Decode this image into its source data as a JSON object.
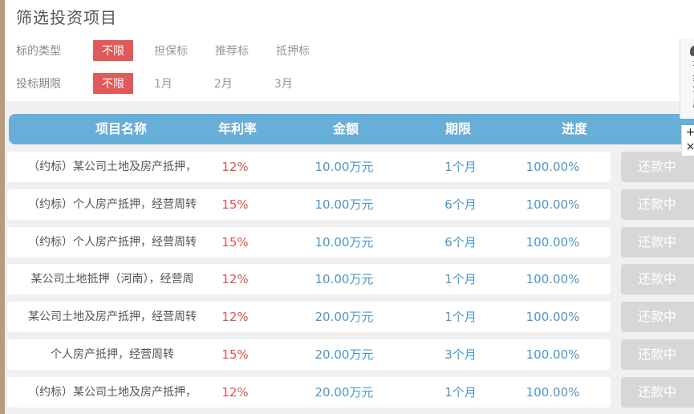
{
  "page_title": "筛选投资项目",
  "filters": [
    {
      "label": "标的类型",
      "options": [
        "不限",
        "担保标",
        "推荐标",
        "抵押标"
      ],
      "selected": 0
    },
    {
      "label": "投标期限",
      "options": [
        "不限",
        "1月",
        "2月",
        "3月"
      ],
      "selected": 0
    }
  ],
  "table": {
    "columns": [
      "项目名称",
      "年利率",
      "金额",
      "期限",
      "进度"
    ],
    "rows": [
      {
        "name": "（约标）某公司土地及房产抵押，",
        "rate": "12%",
        "amount": "10.00万元",
        "term": "1个月",
        "progress": "100.00%",
        "status": "还款中"
      },
      {
        "name": "（约标）个人房产抵押，经营周转",
        "rate": "15%",
        "amount": "10.00万元",
        "term": "6个月",
        "progress": "100.00%",
        "status": "还款中"
      },
      {
        "name": "（约标）个人房产抵押，经营周转",
        "rate": "15%",
        "amount": "10.00万元",
        "term": "6个月",
        "progress": "100.00%",
        "status": "还款中"
      },
      {
        "name": "某公司土地抵押（河南），经营周",
        "rate": "12%",
        "amount": "10.00万元",
        "term": "1个月",
        "progress": "100.00%",
        "status": "还款中"
      },
      {
        "name": "某公司土地及房产抵押，经营周转",
        "rate": "12%",
        "amount": "20.00万元",
        "term": "1个月",
        "progress": "100.00%",
        "status": "还款中"
      },
      {
        "name": "个人房产抵押，经营周转",
        "rate": "15%",
        "amount": "20.00万元",
        "term": "3个月",
        "progress": "100.00%",
        "status": "还款中"
      },
      {
        "name": "（约标）某公司土地及房产抵押，",
        "rate": "12%",
        "amount": "20.00万元",
        "term": "1个月",
        "progress": "100.00%",
        "status": "还款中"
      }
    ]
  },
  "side_widget": {
    "icon": "chat-icon",
    "chars": [
      "在",
      "线",
      "客",
      "服"
    ],
    "expand": "+",
    "close": "×"
  },
  "colors": {
    "header_blue": "#67aed8",
    "active_red": "#e05a5a",
    "rate_red": "#e05252",
    "value_blue": "#4f95c7",
    "status_gray": "#d7d7d7"
  }
}
